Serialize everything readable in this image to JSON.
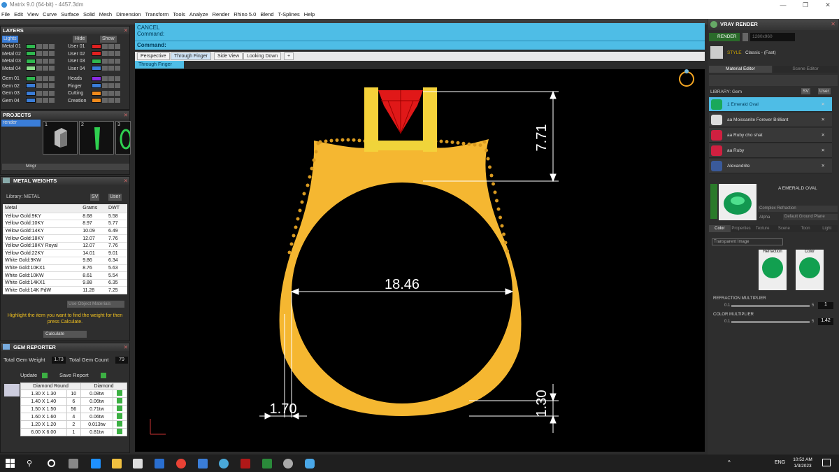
{
  "window": {
    "title": "Matrix 9.0 (64-bit) - 4457.3dm",
    "controls": [
      "—",
      "❐",
      "✕"
    ]
  },
  "menu": [
    "File",
    "Edit",
    "View",
    "Curve",
    "Surface",
    "Solid",
    "Mesh",
    "Dimension",
    "Transform",
    "Tools",
    "Analyze",
    "Render",
    "Rhino 5.0",
    "Blend",
    "T-Splines",
    "Help"
  ],
  "layers": {
    "title": "LAYERS",
    "lights": "Lights",
    "hide": "Hide",
    "show": "Show",
    "left": [
      {
        "label": "Metal 01",
        "color": "#2fb84f"
      },
      {
        "label": "Metal 02",
        "color": "#2fb84f"
      },
      {
        "label": "Metal 03",
        "color": "#2fb84f"
      },
      {
        "label": "Metal 04",
        "color": "#8ee08e"
      },
      {
        "label": "Gem 01",
        "color": "#2fb84f"
      },
      {
        "label": "Gem 02",
        "color": "#3a7dd8"
      },
      {
        "label": "Gem 03",
        "color": "#3a7dd8"
      },
      {
        "label": "Gem 04",
        "color": "#3a7dd8"
      }
    ],
    "right": [
      {
        "label": "User 01",
        "color": "#e02020"
      },
      {
        "label": "User 02",
        "color": "#e02020"
      },
      {
        "label": "User 03",
        "color": "#2fb84f"
      },
      {
        "label": "User 04",
        "color": "#3a7dd8"
      },
      {
        "label": "Heads",
        "color": "#8a2be2"
      },
      {
        "label": "Finger",
        "color": "#3a7dd8"
      },
      {
        "label": "Cutting",
        "color": "#f08a1c"
      },
      {
        "label": "Creation",
        "color": "#f08a1c"
      }
    ]
  },
  "projects": {
    "title": "PROJECTS",
    "render": "render",
    "items": [
      "1",
      "2",
      "3"
    ],
    "mngr": "Mngr"
  },
  "metal_weights": {
    "title": "METAL WEIGHTS",
    "library": "Library: METAL",
    "sv": "SV",
    "user": "User",
    "headers": [
      "Metal",
      "Grams",
      "DWT"
    ],
    "rows": [
      [
        "Yellow Gold:9KY",
        "8.68",
        "5.58"
      ],
      [
        "Yellow Gold:10KY",
        "8.97",
        "5.77"
      ],
      [
        "Yellow Gold:14KY",
        "10.09",
        "6.49"
      ],
      [
        "Yellow Gold:18KY",
        "12.07",
        "7.76"
      ],
      [
        "Yellow Gold:18KY Royal",
        "12.07",
        "7.76"
      ],
      [
        "Yellow Gold:22KY",
        "14.01",
        "9.01"
      ],
      [
        "White Gold:9KW",
        "9.86",
        "6.34"
      ],
      [
        "White Gold:10KX1",
        "8.76",
        "5.63"
      ],
      [
        "White Gold:10KW",
        "8.61",
        "5.54"
      ],
      [
        "White Gold:14KX1",
        "9.88",
        "6.35"
      ],
      [
        "White Gold:14K PdW",
        "11.28",
        "7.25"
      ]
    ],
    "use_object_materials": "Use Object Materials",
    "hint": "Highlight the item you want to find the weight for then press Calculate.",
    "calculate": "Calculate"
  },
  "gem_reporter": {
    "title": "GEM REPORTER",
    "total_weight_label": "Total Gem Weight",
    "total_weight": "1.73",
    "total_count_label": "Total Gem Count",
    "total_count": "79",
    "update": "Update",
    "save_report": "Save Report",
    "headers": [
      "Diamond Round",
      "Diamond"
    ],
    "rows": [
      [
        "1.30 X 1.30",
        "10",
        "0.08tw"
      ],
      [
        "1.40 X 1.40",
        "6",
        "0.06tw"
      ],
      [
        "1.50 X 1.50",
        "56",
        "0.71tw"
      ],
      [
        "1.60 X 1.60",
        "4",
        "0.06tw"
      ],
      [
        "1.20 X 1.20",
        "2",
        "0.013tw"
      ],
      [
        "6.00 X 6.00",
        "1",
        "0.81tw"
      ]
    ]
  },
  "command": {
    "line1": "CANCEL",
    "line2": "Command:",
    "prompt": "Command:"
  },
  "view_tabs": [
    "Perspective",
    "Through Finger",
    "Side View",
    "Looking Down",
    "+"
  ],
  "active_view": "Through Finger",
  "dimensions": {
    "top": "7.71",
    "inner": "18.46",
    "left": "1.70",
    "bottom": "1.30"
  },
  "vray": {
    "title": "VRAY RENDER",
    "render": "RENDER",
    "resolution": "1280x960",
    "style_label": "STYLE",
    "style": "Classic - (Fast)",
    "tabs": [
      "Material Editor",
      "Scene Editor"
    ],
    "library": "LIBRARY: Gem",
    "sv": "SV",
    "user": "User",
    "items": [
      {
        "label": "1 Emerald Oval",
        "color": "#1aa85a"
      },
      {
        "label": "aa Moissanite Forever Brilliant",
        "color": "#dddddd"
      },
      {
        "label": "aa Ruby cho shat",
        "color": "#d02040"
      },
      {
        "label": "aa Ruby",
        "color": "#d02040"
      },
      {
        "label": "Alexandrite",
        "color": "#3a5a9a"
      }
    ],
    "preview_name": "A EMERALD OVAL",
    "complex": "Complex Refraction",
    "alpha": "Alpha",
    "ground": "Default Ground Plane",
    "subtabs": [
      "Color",
      "Properties",
      "Texture",
      "Scene",
      "Toon",
      "Light"
    ],
    "transparent": "Transparent Image",
    "refraction": "Refraction",
    "color": "Color",
    "refraction_multiplier": "REFRACTION MULTIPLIER",
    "ref_min": "0.1",
    "ref_max": "5",
    "ref_val": "1",
    "color_multiplier": "COLOR MULTIPLIER",
    "col_min": "0.1",
    "col_max": "5",
    "col_val": "1.42"
  },
  "taskbar": {
    "lang": "ENG",
    "time": "10:52 AM",
    "date": "1/3/2023"
  }
}
